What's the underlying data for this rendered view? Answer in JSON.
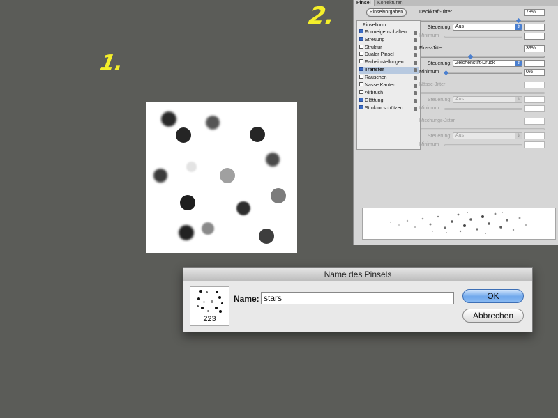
{
  "annotations": [
    "1.",
    "2."
  ],
  "brush_panel": {
    "tabs": [
      "Pinsel",
      "Korrekturen"
    ],
    "presets_button": "Pinselvorgaben",
    "list": [
      {
        "label": "Pinselform",
        "checkbox": false,
        "header": true,
        "checked": false,
        "selected": false
      },
      {
        "label": "Formeigenschaften",
        "checkbox": true,
        "checked": true,
        "selected": false
      },
      {
        "label": "Streuung",
        "checkbox": true,
        "checked": true,
        "selected": false
      },
      {
        "label": "Struktur",
        "checkbox": true,
        "checked": false,
        "selected": false
      },
      {
        "label": "Dualer Pinsel",
        "checkbox": true,
        "checked": false,
        "selected": false
      },
      {
        "label": "Farbeinstellungen",
        "checkbox": true,
        "checked": false,
        "selected": false
      },
      {
        "label": "Transfer",
        "checkbox": true,
        "checked": true,
        "selected": true
      },
      {
        "label": "Rauschen",
        "checkbox": true,
        "checked": false,
        "selected": false
      },
      {
        "label": "Nasse Kanten",
        "checkbox": true,
        "checked": false,
        "selected": false
      },
      {
        "label": "Airbrush",
        "checkbox": true,
        "checked": false,
        "selected": false
      },
      {
        "label": "Glättung",
        "checkbox": true,
        "checked": true,
        "selected": false
      },
      {
        "label": "Struktur schützen",
        "checkbox": true,
        "checked": true,
        "selected": false
      }
    ],
    "deckkraft_label": "Deckkraft-Jitter",
    "deckkraft_value": "78%",
    "steuerung_label": "Steuerung:",
    "steuerung_1": "Aus",
    "minimum_label": "Minimum",
    "fluss_label": "Fluss-Jitter",
    "fluss_value": "39%",
    "steuerung_2": "Zeichenstift-Druck",
    "minimum_2_value": "0%",
    "naesse_label": "Nässe-Jitter",
    "steuerung_3": "Aus",
    "mischungs_label": "Mischungs-Jitter",
    "steuerung_4": "Aus"
  },
  "dialog": {
    "title": "Name des Pinsels",
    "brush_count": "223",
    "name_label": "Name:",
    "name_value": "stars",
    "ok_label": "OK",
    "cancel_label": "Abbrechen"
  },
  "colors": {
    "background": "#5b5c58",
    "annotation": "#f4ee2a",
    "ok_button": "#6fa7ec"
  }
}
